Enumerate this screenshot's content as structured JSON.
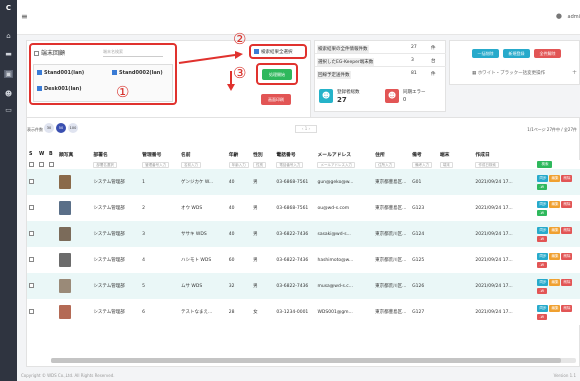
{
  "topbar": {
    "user_label": "admi"
  },
  "filter": {
    "group_label": "端末回顧",
    "search_placeholder": "端末名検索",
    "terminals": [
      "Stand001(lan)",
      "Stand0002(lan)",
      "Desk001(lan)"
    ],
    "select_all_label": "検索結果全選択",
    "circled": [
      "①",
      "②",
      "③"
    ],
    "apply_label": "処理開始",
    "cancel_label": "画面印刷"
  },
  "stats": {
    "rows": [
      {
        "label": "検索結果の全件情報件数",
        "value": "27",
        "unit": "件"
      },
      {
        "label": "選択したEG-Keeper端末数",
        "value": "3",
        "unit": "台"
      },
      {
        "label": "回線予定送件数",
        "value": "81",
        "unit": "件"
      }
    ],
    "registered_label": "登録者総数",
    "registered_value": "27",
    "sync_label": "同期エラー",
    "sync_value": "0"
  },
  "actions": {
    "buttons": [
      "一括削除",
      "新規登録",
      "全件解除"
    ],
    "whitelist_label": "ホワイト・ブラックー括変更操作"
  },
  "pager": {
    "count_label": "表示件数",
    "sizes": [
      "30",
      "50",
      "100"
    ],
    "info": "1/1ページ 27件中 / 全27件"
  },
  "table": {
    "headers": [
      "S",
      "W",
      "B",
      "顔写真",
      "部署名",
      "管理番号",
      "名前",
      "年齢",
      "性別",
      "電話番号",
      "メールアドレス",
      "住所",
      "備考",
      "端末",
      "作成日"
    ],
    "filters": [
      "部署名選択",
      "管理番号入力",
      "名前入力",
      "年齢入力",
      "性別",
      "電話番号入力",
      "メールアドレス入力",
      "住所入力",
      "備考入力",
      "端末",
      "作成日検索"
    ],
    "search_label": "検索",
    "rows": [
      {
        "dept": "システム管理部",
        "no": "1",
        "name": "ゲンジカケ W...",
        "age": "40",
        "sex": "男",
        "tel": "03-6868-7561",
        "mail": "gun@geko@w...",
        "addr": "東京都豊島区...",
        "note": "G01",
        "created": "2021/09/24 17..."
      },
      {
        "dept": "システム管理部",
        "no": "2",
        "name": "オウ WDS",
        "age": "40",
        "sex": "男",
        "tel": "03-6868-7561",
        "mail": "ou@wd-s.com",
        "addr": "東京都豊島区...",
        "note": "G123",
        "created": "2021/09/24 17..."
      },
      {
        "dept": "システム管理部",
        "no": "3",
        "name": "ササキ WDS",
        "age": "40",
        "sex": "男",
        "tel": "03-6822-7436",
        "mail": "sasaki@wd-s...",
        "addr": "東京都荒川区...",
        "note": "G124",
        "created": "2021/09/24 17..."
      },
      {
        "dept": "システム管理部",
        "no": "4",
        "name": "ハシモト WDS",
        "age": "60",
        "sex": "男",
        "tel": "03-6822-7436",
        "mail": "hashimoto@w...",
        "addr": "東京都荒川区...",
        "note": "G125",
        "created": "2021/09/24 17..."
      },
      {
        "dept": "システム管理部",
        "no": "5",
        "name": "ムサ WDS",
        "age": "32",
        "sex": "男",
        "tel": "03-6822-7436",
        "mail": "musa@wd-s.c...",
        "addr": "東京都荒川区...",
        "note": "G126",
        "created": "2021/09/24 17..."
      },
      {
        "dept": "システム管理部",
        "no": "6",
        "name": "テストなまえ...",
        "age": "28",
        "sex": "女",
        "tel": "03-1234-0001",
        "mail": "WDS001@gm...",
        "addr": "東京都豊島区...",
        "note": "G127",
        "created": "2021/09/24 17..."
      }
    ],
    "row_actions": [
      "同步",
      "編集",
      "削除"
    ],
    "w_label": "-W"
  },
  "footer": {
    "copyright": "Copyright © WDS Co.,Ltd. All Rights Reserved.",
    "version": "Version 1.1"
  }
}
